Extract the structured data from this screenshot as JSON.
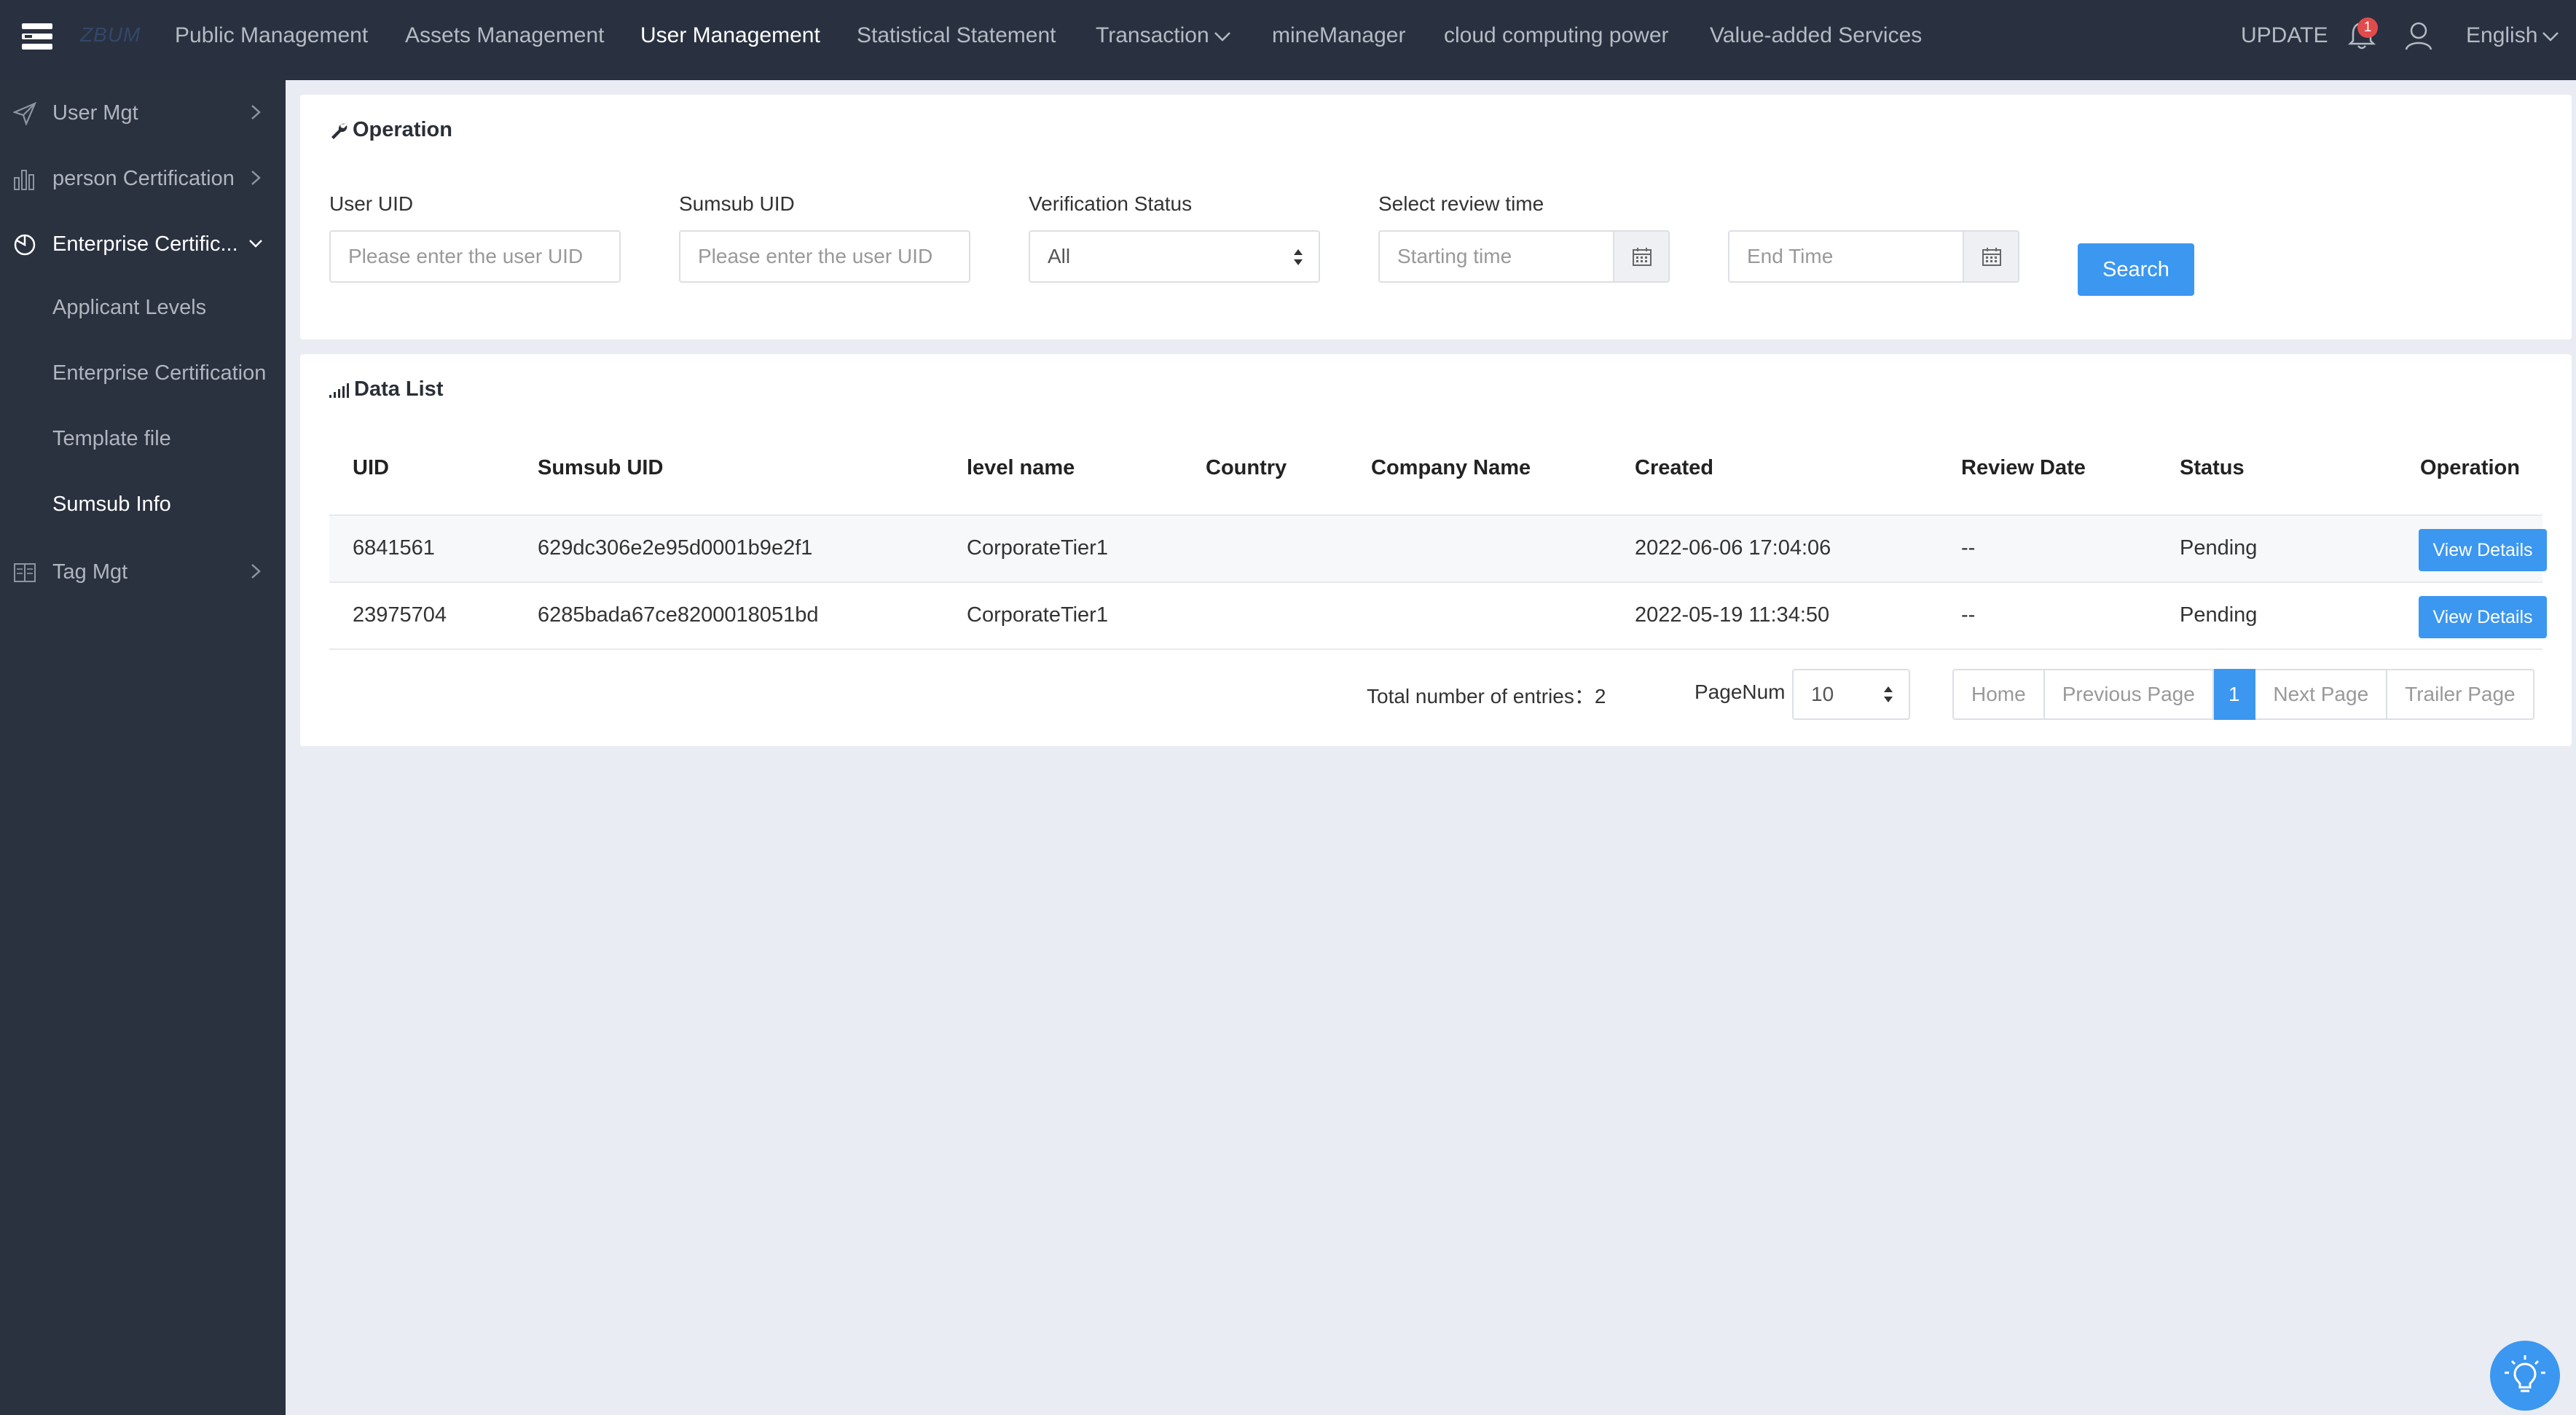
{
  "topbar": {
    "logo": "ZBUM",
    "nav": [
      {
        "label": "Public Management"
      },
      {
        "label": "Assets Management"
      },
      {
        "label": "User Management",
        "active": true
      },
      {
        "label": "Statistical Statement"
      },
      {
        "label": "Transaction",
        "dropdown": true
      },
      {
        "label": "mineManager"
      },
      {
        "label": "cloud computing power"
      },
      {
        "label": "Value-added Services"
      }
    ],
    "update_label": "UPDATE",
    "notification_count": "1",
    "language": "English"
  },
  "sidebar": {
    "items": [
      {
        "label": "User Mgt",
        "icon": "send-icon"
      },
      {
        "label": "person Certification",
        "icon": "bar-chart-icon"
      },
      {
        "label": "Enterprise Certific...",
        "icon": "pie-icon",
        "open": true
      },
      {
        "label": "Tag Mgt",
        "icon": "book-icon"
      }
    ],
    "subitems": [
      {
        "label": "Applicant Levels"
      },
      {
        "label": "Enterprise Certification"
      },
      {
        "label": "Template file"
      },
      {
        "label": "Sumsub Info",
        "active": true
      }
    ]
  },
  "operation": {
    "title": "Operation",
    "user_uid_label": "User UID",
    "user_uid_placeholder": "Please enter the user UID",
    "sumsub_uid_label": "Sumsub UID",
    "sumsub_uid_placeholder": "Please enter the user UID",
    "status_label": "Verification Status",
    "status_value": "All",
    "review_time_label": "Select review time",
    "start_placeholder": "Starting time",
    "end_placeholder": "End Time",
    "search_label": "Search"
  },
  "data_list": {
    "title": "Data List",
    "columns": [
      "UID",
      "Sumsub UID",
      "level name",
      "Country",
      "Company Name",
      "Created",
      "Review Date",
      "Status",
      "Operation"
    ],
    "rows": [
      {
        "uid": "6841561",
        "sumsub_uid": "629dc306e2e95d0001b9e2f1",
        "level": "CorporateTier1",
        "country": "",
        "company": "",
        "created": "2022-06-06 17:04:06",
        "review_date": "--",
        "status": "Pending",
        "action": "View Details"
      },
      {
        "uid": "23975704",
        "sumsub_uid": "6285bada67ce8200018051bd",
        "level": "CorporateTier1",
        "country": "",
        "company": "",
        "created": "2022-05-19 11:34:50",
        "review_date": "--",
        "status": "Pending",
        "action": "View Details"
      }
    ],
    "total_label": "Total number of entries：",
    "total_value": "2",
    "pagenum_label": "PageNum",
    "pagenum_value": "10",
    "pager": {
      "home": "Home",
      "prev": "Previous Page",
      "current": "1",
      "next": "Next Page",
      "last": "Trailer Page"
    }
  },
  "colors": {
    "topbar_bg": "#293140",
    "sidebar_bg": "#2a313f",
    "accent": "#3b97f0",
    "page_bg": "#e9ecf3",
    "badge": "#e14b4b"
  }
}
